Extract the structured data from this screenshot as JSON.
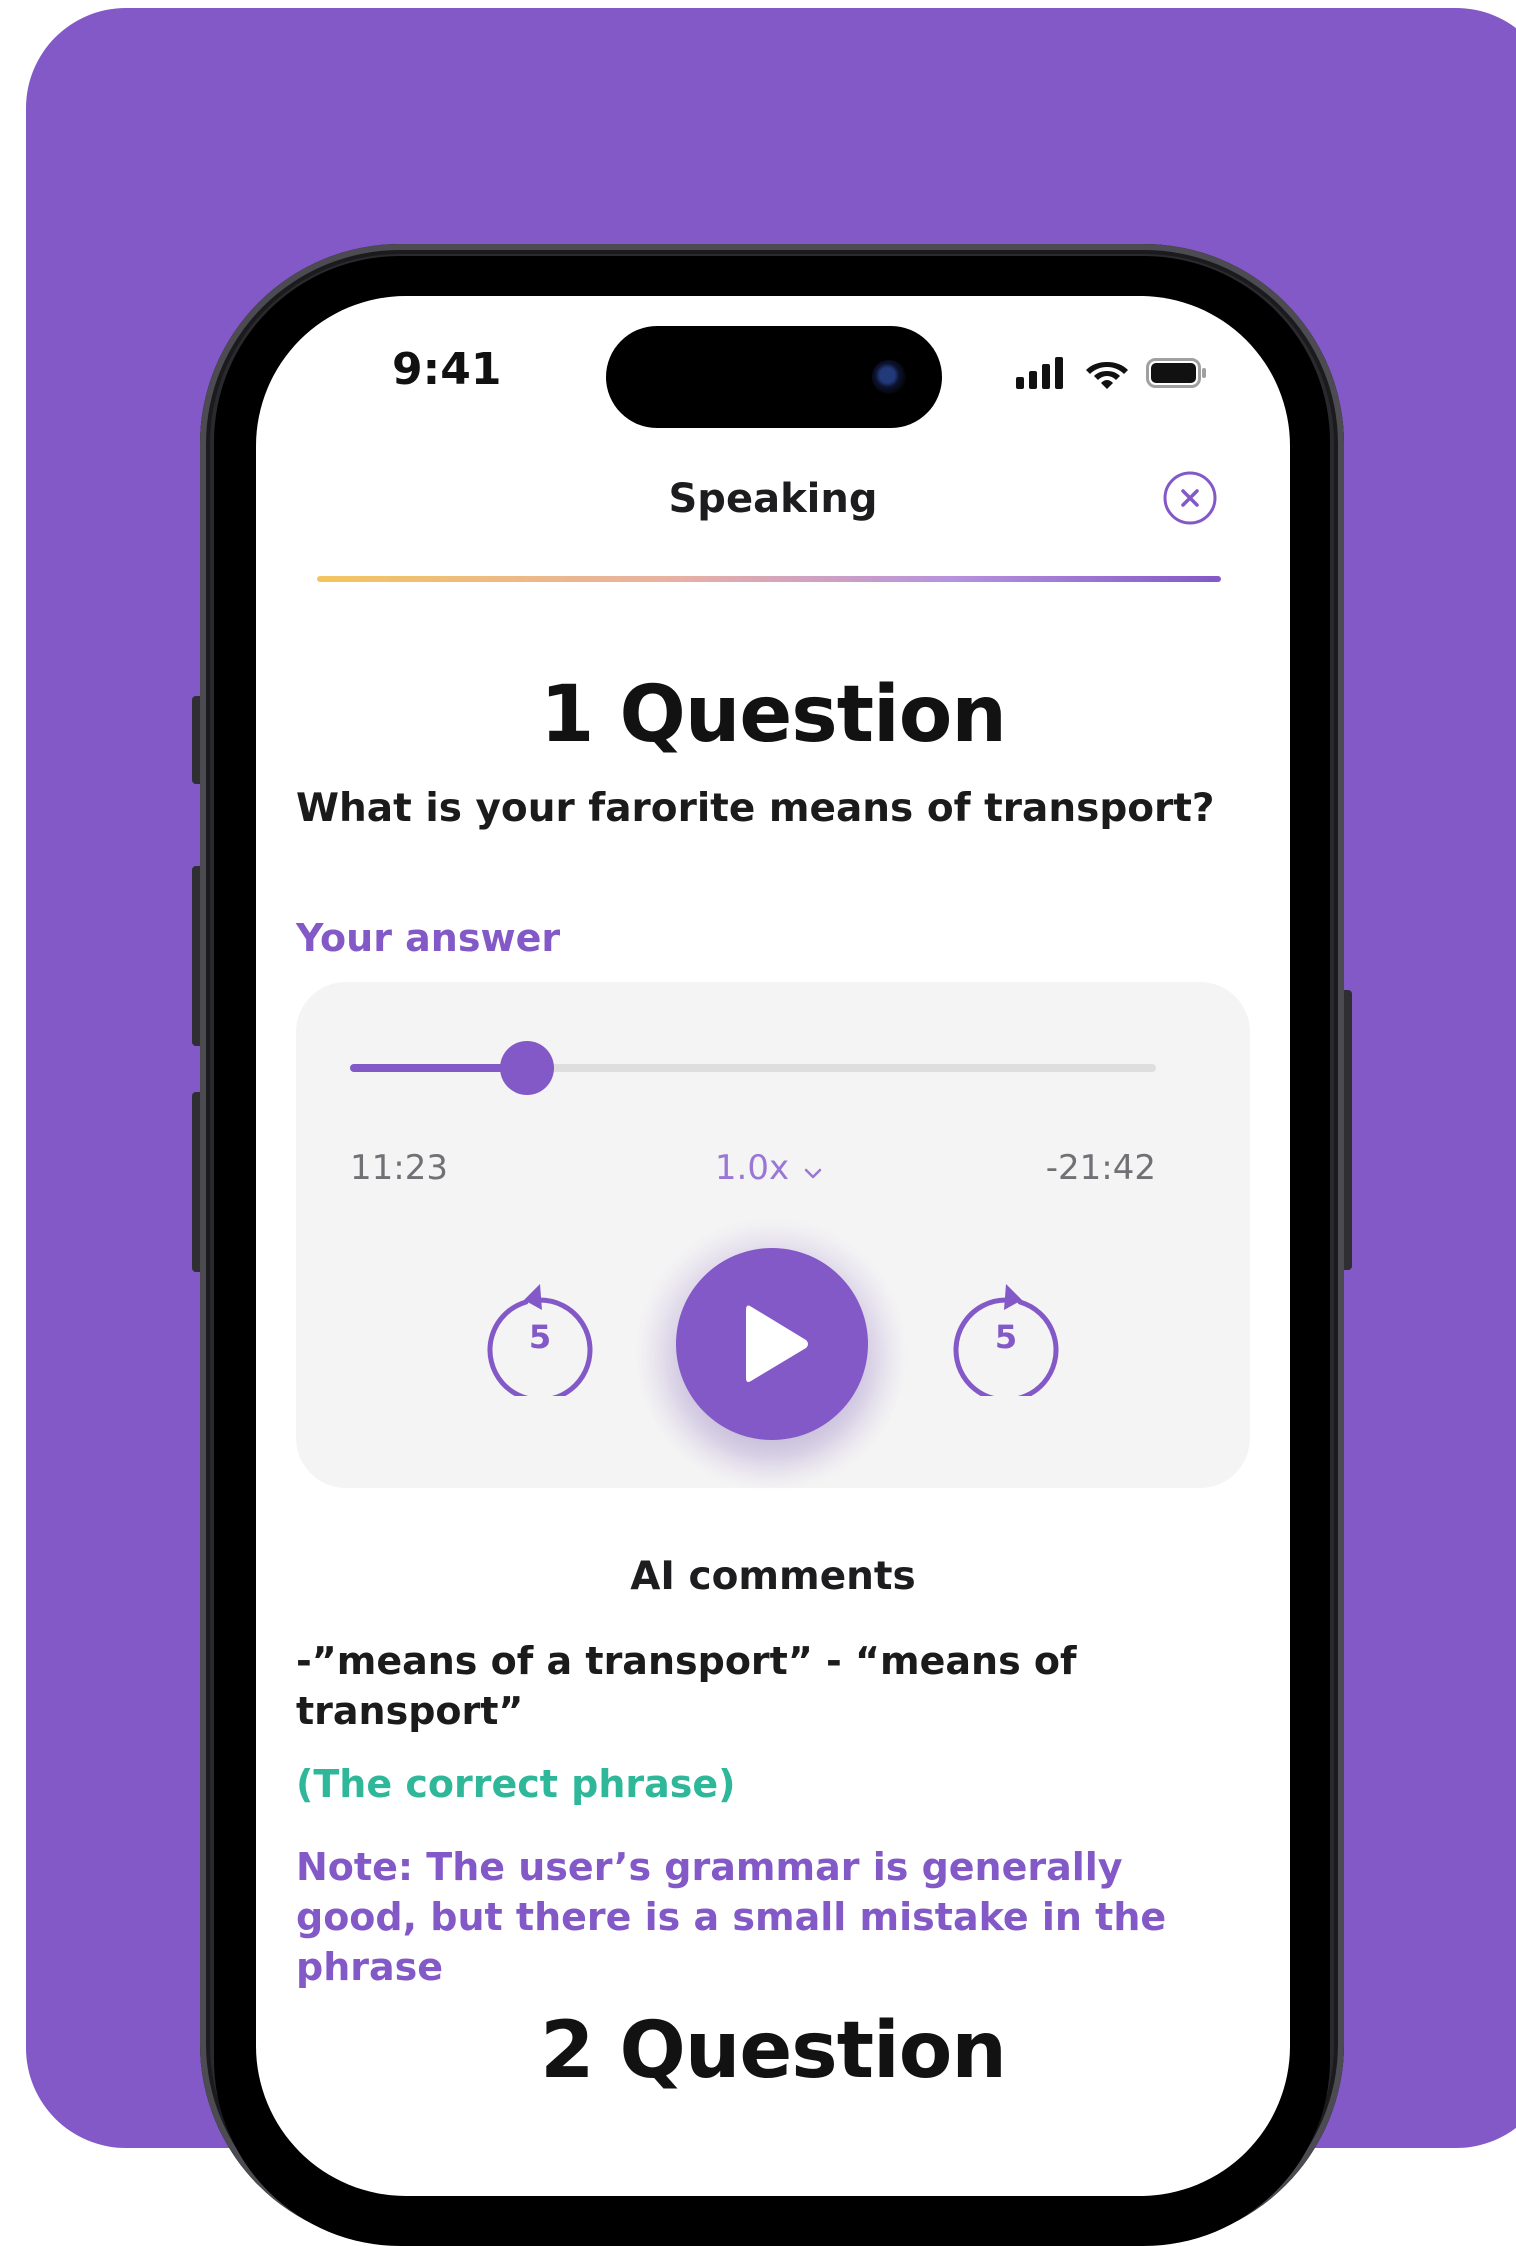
{
  "status_bar": {
    "time": "9:41",
    "icons": [
      "signal-icon",
      "wifi-icon",
      "battery-icon"
    ]
  },
  "header": {
    "title": "Speaking",
    "close_icon": "close-icon"
  },
  "question_1": {
    "title": "1 Question",
    "text": "What is your farorite means of transport?"
  },
  "answer": {
    "label": "Your answer",
    "progress": 0.22,
    "elapsed": "11:23",
    "remaining": "-21:42",
    "speed": "1.0x",
    "rewind_seconds": "5",
    "forward_seconds": "5"
  },
  "ai_comments": {
    "title": "AI comments",
    "comment": "-”means of a transport” - “means of transport”",
    "correct_label": "(The correct phrase)",
    "note": "Note: The user’s grammar is generally good, but there is a small mistake in the phrase"
  },
  "question_2": {
    "title": "2 Question"
  },
  "colors": {
    "background": "#8358c7",
    "accent": "#8358c7",
    "correct": "#2fb79a",
    "progress_start": "#f3c55f",
    "progress_end": "#8358c7"
  }
}
